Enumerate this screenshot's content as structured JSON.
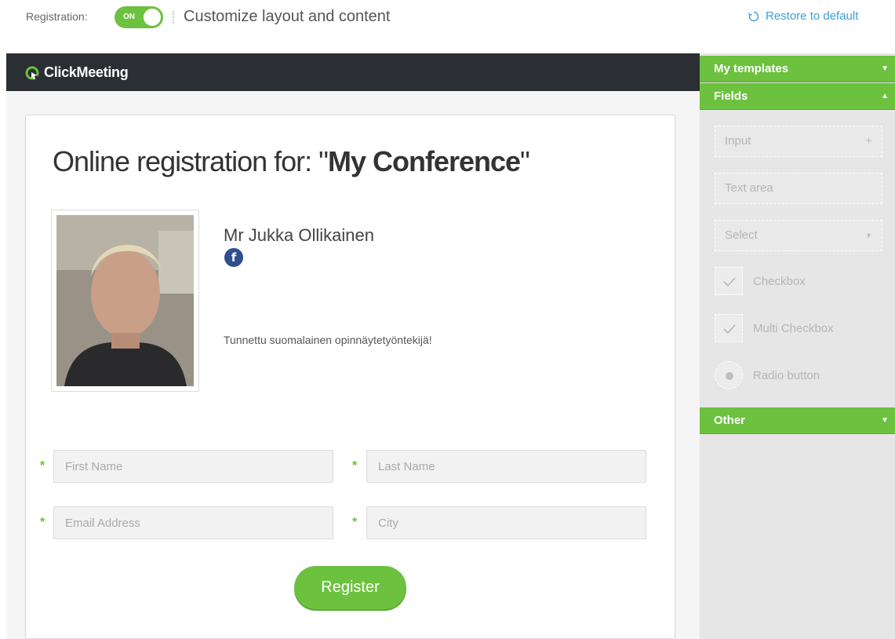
{
  "topbar": {
    "registration_label": "Registration:",
    "toggle_label": "ON",
    "customize_label": "Customize layout and content",
    "restore_label": "Restore to default"
  },
  "header": {
    "logo_text": "ClickMeeting"
  },
  "form": {
    "title_prefix": "Online registration for: \"",
    "title_event": "My Conference",
    "title_suffix": "\"",
    "presenter_name": "Mr Jukka Ollikainen",
    "presenter_bio": "Tunnettu suomalainen opinnäytetyöntekijä!",
    "fields": {
      "first_name": "First Name",
      "last_name": "Last Name",
      "email": "Email Address",
      "city": "City"
    },
    "required_marker": "*",
    "register_label": "Register"
  },
  "sidebar": {
    "my_templates": "My templates",
    "fields_header": "Fields",
    "other": "Other",
    "items": {
      "input": "Input",
      "textarea": "Text area",
      "select": "Select",
      "checkbox": "Checkbox",
      "multi_checkbox": "Multi Checkbox",
      "radio": "Radio button"
    }
  },
  "colors": {
    "accent": "#6cc13f",
    "header_bg": "#2b2e33",
    "link": "#3aa0d8"
  }
}
